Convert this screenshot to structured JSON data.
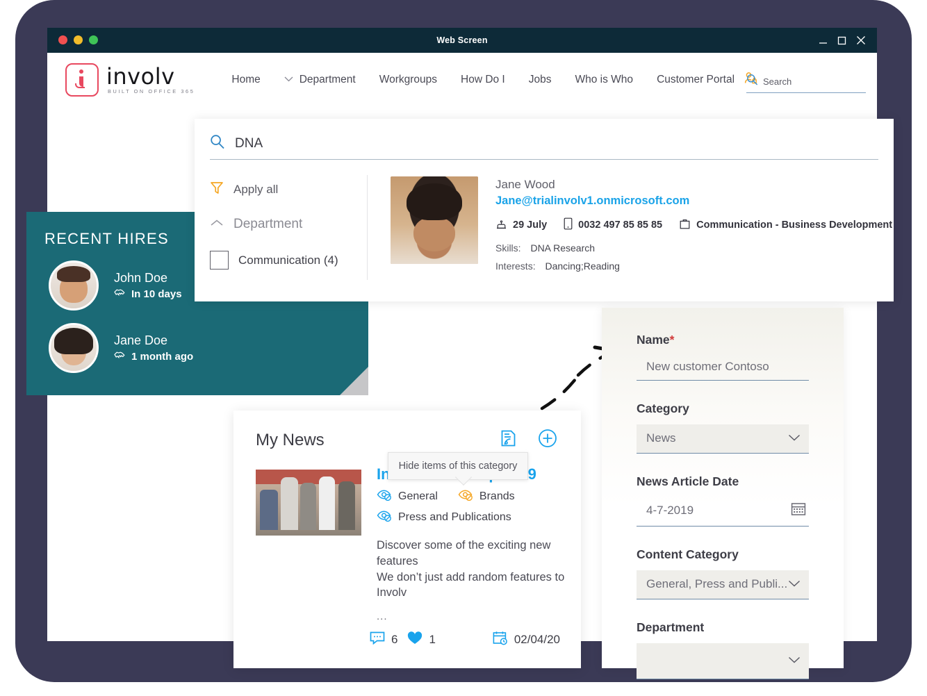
{
  "window": {
    "title": "Web Screen",
    "controls": {
      "minimize": "minimize-icon",
      "maximize": "maximize-icon",
      "close": "close-icon"
    },
    "dots": [
      "close-dot",
      "minimize-dot",
      "zoom-dot"
    ]
  },
  "brand": {
    "name": "involv",
    "tagline": "BUILT ON OFFICE 365"
  },
  "nav": {
    "items": [
      {
        "label": "Home",
        "chevron": false
      },
      {
        "label": "Department",
        "chevron": true
      },
      {
        "label": "Workgroups",
        "chevron": false
      },
      {
        "label": "How Do I",
        "chevron": false
      },
      {
        "label": "Jobs",
        "chevron": false
      },
      {
        "label": "Who is Who",
        "chevron": false
      },
      {
        "label": "Customer Portal",
        "chevron": false
      }
    ],
    "search_placeholder": "Search"
  },
  "search_overlay": {
    "query": "DNA",
    "filters": {
      "apply_all": "Apply all",
      "group_label": "Department",
      "options": [
        {
          "label": "Communication (4)",
          "checked": false
        }
      ]
    },
    "result": {
      "name": "Jane Wood",
      "email": "Jane@trialinvolv1.onmicrosoft.com",
      "birthday": "29 July",
      "phone": "0032 497 85 85 85",
      "department": "Communication - Business Development",
      "skills_label": "Skills:",
      "skills_value": "DNA Research",
      "interests_label": "Interests:",
      "interests_value": "Dancing;Reading"
    }
  },
  "recent_hires": {
    "title": "RECENT HIRES",
    "items": [
      {
        "name": "John Doe",
        "when": "In 10 days"
      },
      {
        "name": "Jane Doe",
        "when": "1 month ago"
      }
    ]
  },
  "my_news": {
    "title": "My News",
    "tooltip": "Hide items of this category",
    "article": {
      "title": "Involv Road Map 2019",
      "categories": [
        {
          "label": "General",
          "color": "#1ba1e6"
        },
        {
          "label": "Brands",
          "color": "#f5a623"
        },
        {
          "label": "Press and Publications",
          "color": "#1ba1e6"
        }
      ],
      "body": "Discover some of the exciting new features\nWe don’t just add random features to Involv",
      "ellipsis": "...",
      "comments": "6",
      "likes": "1",
      "date": "02/04/20"
    }
  },
  "form": {
    "fields": [
      {
        "label": "Name",
        "required": true,
        "type": "text",
        "value": "New customer Contoso"
      },
      {
        "label": "Category",
        "required": false,
        "type": "select",
        "value": "News"
      },
      {
        "label": "News Article Date",
        "required": false,
        "type": "date",
        "value": "4-7-2019"
      },
      {
        "label": "Content Category",
        "required": false,
        "type": "select",
        "value": "General, Press and Publi..."
      },
      {
        "label": "Department",
        "required": false,
        "type": "select",
        "value": ""
      }
    ],
    "required_marker": "*"
  },
  "colors": {
    "backdrop": "#3b3a56",
    "titlebar": "#0d2a38",
    "teal": "#1b6a76",
    "accent_blue": "#19a3ec",
    "brand_red": "#e8485f",
    "orange": "#f5a623"
  }
}
